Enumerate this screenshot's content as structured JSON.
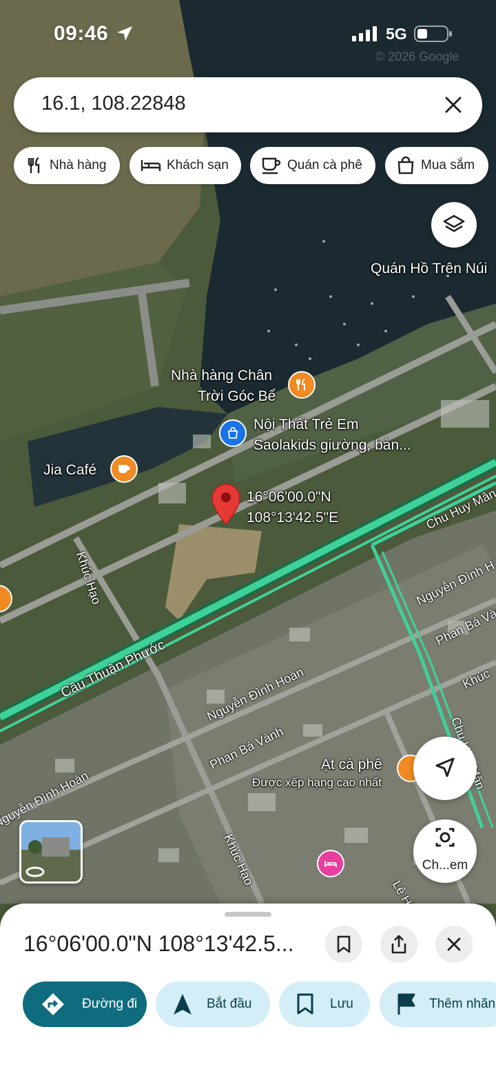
{
  "status_bar": {
    "time": "09:46",
    "network": "5G"
  },
  "map_copyright": "© 2026 Google",
  "search": {
    "query": "16.1, 108.22848"
  },
  "chips": [
    {
      "label": "Nhà hàng",
      "icon": "fork-knife-icon"
    },
    {
      "label": "Khách sạn",
      "icon": "bed-icon"
    },
    {
      "label": "Quán cà phê",
      "icon": "coffee-cup-icon"
    },
    {
      "label": "Mua sắm",
      "icon": "shopping-bag-icon"
    }
  ],
  "map": {
    "places": {
      "quan_ho": "Quán Hồ Trên Núi",
      "nha_hang_line1": "Nhà hàng Chân",
      "nha_hang_line2": "Trời Góc Bể",
      "noi_that_line1": "Nội Thất Trẻ Em",
      "noi_that_line2": "Saolakids giường, bàn...",
      "jia_cafe": "Jia Café",
      "at_ca_phe": "Ạt cà phê",
      "at_ca_phe_sub": "Được xếp hạng cao nhất"
    },
    "pin_label": {
      "lat": "16°06'00.0\"N",
      "lng": "108°13'42.5\"E"
    },
    "roads": {
      "chu_huy_man_1": "Chu Huy Mân",
      "chu_huy_man_2": "Chu Huy Mân",
      "khuc_hao_1": "Khúc Hạo",
      "khuc_hao_2": "Khúc Hạo",
      "khuc_hao_3": "Khúc",
      "cau_thuan_phuoc": "Cầu Thuận Phước",
      "nguyen_dinh_hoan_1": "Nguyễn Đình Hoàn",
      "nguyen_dinh_hoan_2": "Nguyễn Đình Hoàn",
      "nguyen_dinh_hoan_3": "Nguyễn Đình H",
      "phan_ba_vanh_1": "Phan Bá Vành",
      "phan_ba_vanh_2": "Phan Bá Vàn",
      "le_huu": "Lê Hữu"
    }
  },
  "side_buttons": {
    "lens_label": "Ch...em"
  },
  "sheet": {
    "title": "16°06'00.0\"N 108°13'42.5...",
    "actions": [
      {
        "label": "Đường đi",
        "icon": "directions-icon"
      },
      {
        "label": "Bắt đầu",
        "icon": "navigation-arrow-icon"
      },
      {
        "label": "Lưu",
        "icon": "bookmark-icon"
      },
      {
        "label": "Thêm nhãn",
        "icon": "flag-icon"
      }
    ]
  },
  "colors": {
    "primary": "#0f6b7e",
    "tonal": "#d3eef6",
    "pin": "#e53935",
    "route": "#3fd19a",
    "poi_orange": "#f08a24",
    "poi_blue": "#1a73e8",
    "poi_pink": "#e93e9e"
  }
}
